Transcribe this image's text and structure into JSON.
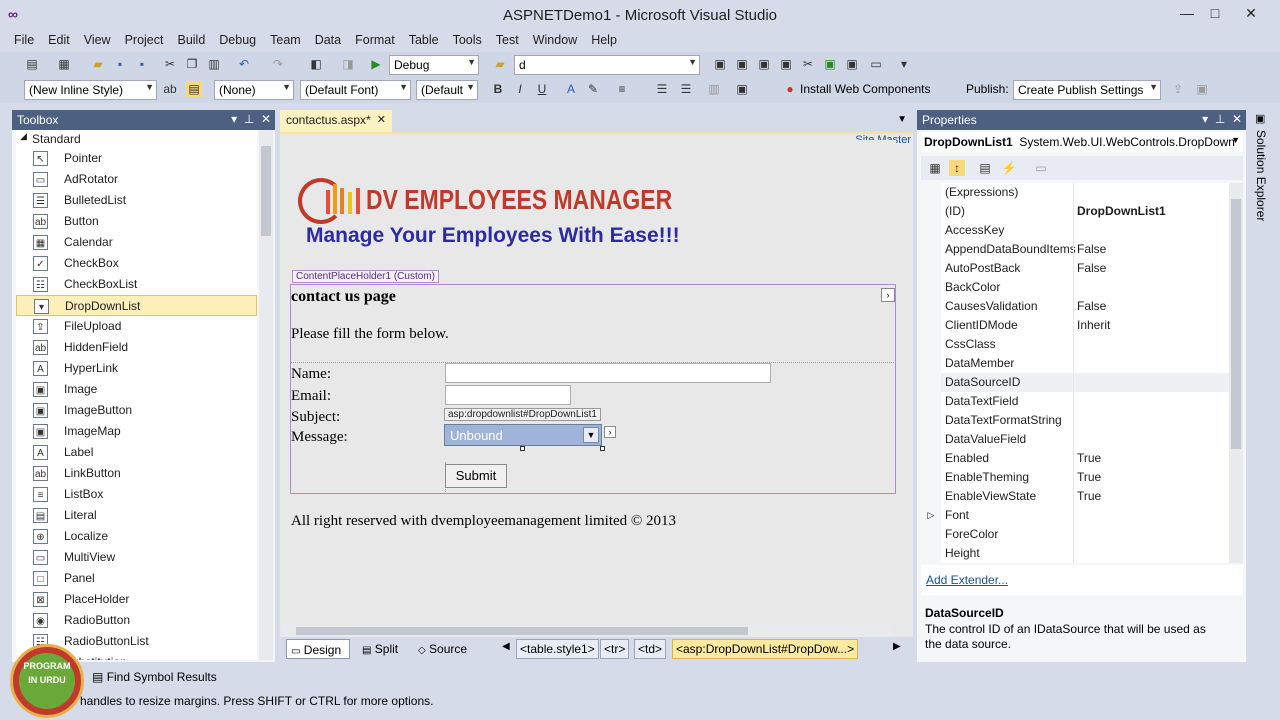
{
  "window": {
    "title": "ASPNETDemo1 - Microsoft Visual Studio"
  },
  "menu": [
    "File",
    "Edit",
    "View",
    "Project",
    "Build",
    "Debug",
    "Team",
    "Data",
    "Format",
    "Table",
    "Tools",
    "Test",
    "Window",
    "Help"
  ],
  "toolbar1": {
    "config": "Debug",
    "find": "d"
  },
  "toolbar2": {
    "style": "(New Inline Style)",
    "block": "(None)",
    "font": "(Default Font)",
    "size": "(Default",
    "install": "Install Web Components",
    "publish_label": "Publish:",
    "publish": "Create Publish Settings"
  },
  "toolbox": {
    "title": "Toolbox",
    "group": "Standard",
    "items": [
      {
        "label": "Pointer",
        "icon": "pointer-icon",
        "glyph": "↖"
      },
      {
        "label": "AdRotator",
        "icon": "adrotator-icon",
        "glyph": "▭"
      },
      {
        "label": "BulletedList",
        "icon": "bulletedlist-icon",
        "glyph": "☰"
      },
      {
        "label": "Button",
        "icon": "button-icon",
        "glyph": "ab"
      },
      {
        "label": "Calendar",
        "icon": "calendar-icon",
        "glyph": "▦"
      },
      {
        "label": "CheckBox",
        "icon": "checkbox-icon",
        "glyph": "✓"
      },
      {
        "label": "CheckBoxList",
        "icon": "checkboxlist-icon",
        "glyph": "☷"
      },
      {
        "label": "DropDownList",
        "icon": "dropdownlist-icon",
        "glyph": "▾",
        "selected": true
      },
      {
        "label": "FileUpload",
        "icon": "fileupload-icon",
        "glyph": "⇪"
      },
      {
        "label": "HiddenField",
        "icon": "hiddenfield-icon",
        "glyph": "ab"
      },
      {
        "label": "HyperLink",
        "icon": "hyperlink-icon",
        "glyph": "A"
      },
      {
        "label": "Image",
        "icon": "image-icon",
        "glyph": "▣"
      },
      {
        "label": "ImageButton",
        "icon": "imagebutton-icon",
        "glyph": "▣"
      },
      {
        "label": "ImageMap",
        "icon": "imagemap-icon",
        "glyph": "▣"
      },
      {
        "label": "Label",
        "icon": "label-icon",
        "glyph": "A"
      },
      {
        "label": "LinkButton",
        "icon": "linkbutton-icon",
        "glyph": "ab"
      },
      {
        "label": "ListBox",
        "icon": "listbox-icon",
        "glyph": "≡"
      },
      {
        "label": "Literal",
        "icon": "literal-icon",
        "glyph": "▤"
      },
      {
        "label": "Localize",
        "icon": "localize-icon",
        "glyph": "⊕"
      },
      {
        "label": "MultiView",
        "icon": "multiview-icon",
        "glyph": "▭"
      },
      {
        "label": "Panel",
        "icon": "panel-icon",
        "glyph": "□"
      },
      {
        "label": "PlaceHolder",
        "icon": "placeholder-icon",
        "glyph": "⊠"
      },
      {
        "label": "RadioButton",
        "icon": "radiobutton-icon",
        "glyph": "◉"
      },
      {
        "label": "RadioButtonList",
        "icon": "radiobuttonlist-icon",
        "glyph": "☷"
      },
      {
        "label": "Substitution",
        "icon": "substitution-icon",
        "glyph": "▭"
      }
    ]
  },
  "document": {
    "tab": "contactus.aspx*",
    "master": "Site.Master",
    "logo_title": "DV EMPLOYEES MANAGER",
    "logo_slogan": "Manage Your Employees With Ease!!!",
    "placeholder_tag": "ContentPlaceHolder1 (Custom)",
    "heading": "contact us page",
    "intro": "Please fill the form below.",
    "labels": {
      "name": "Name:",
      "email": "Email:",
      "subject": "Subject:",
      "message": "Message:"
    },
    "dropdown_tag": "asp:dropdownlist#DropDownList1",
    "dropdown_value": "Unbound",
    "submit": "Submit",
    "footer": "All right reserved with dvemployeemanagement limited © 2013"
  },
  "viewtabs": {
    "design": "Design",
    "split": "Split",
    "source": "Source"
  },
  "breadcrumb": [
    "<table.style1>",
    "<tr>",
    "<td>",
    "<asp:DropDownList#DropDow...>"
  ],
  "properties": {
    "title": "Properties",
    "object": "DropDownList1",
    "type": "System.Web.UI.WebControls.DropDown",
    "rows": [
      {
        "name": "(Expressions)",
        "value": ""
      },
      {
        "name": "(ID)",
        "value": "DropDownList1",
        "bold": true
      },
      {
        "name": "AccessKey",
        "value": ""
      },
      {
        "name": "AppendDataBoundItems",
        "value": "False"
      },
      {
        "name": "AutoPostBack",
        "value": "False"
      },
      {
        "name": "BackColor",
        "value": ""
      },
      {
        "name": "CausesValidation",
        "value": "False"
      },
      {
        "name": "ClientIDMode",
        "value": "Inherit"
      },
      {
        "name": "CssClass",
        "value": ""
      },
      {
        "name": "DataMember",
        "value": ""
      },
      {
        "name": "DataSourceID",
        "value": ""
      },
      {
        "name": "DataTextField",
        "value": ""
      },
      {
        "name": "DataTextFormatString",
        "value": ""
      },
      {
        "name": "DataValueField",
        "value": ""
      },
      {
        "name": "Enabled",
        "value": "True"
      },
      {
        "name": "EnableTheming",
        "value": "True"
      },
      {
        "name": "EnableViewState",
        "value": "True"
      },
      {
        "name": "Font",
        "value": ""
      },
      {
        "name": "ForeColor",
        "value": ""
      },
      {
        "name": "Height",
        "value": ""
      }
    ],
    "add_extender": "Add Extender...",
    "desc_title": "DataSourceID",
    "desc_text": "The control ID of an IDataSource that will be used as the data source."
  },
  "solution_explorer": "Solution Explorer",
  "find_symbol": "Find Symbol Results",
  "status": "handles to resize margins. Press SHIFT or CTRL for more options.",
  "watermark": "PROGRAM IN URDU"
}
